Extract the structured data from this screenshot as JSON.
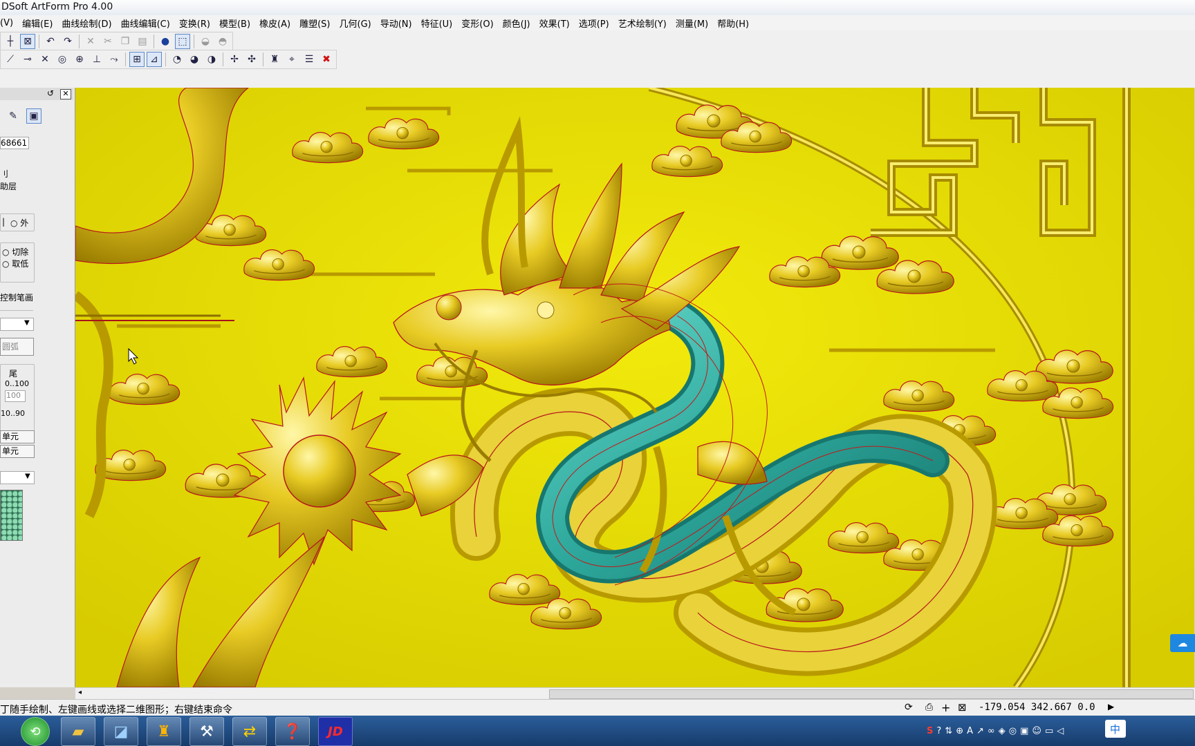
{
  "window": {
    "title": "DSoft ArtForm Pro 4.00"
  },
  "menu": [
    "(V)",
    "编辑(E)",
    "曲线绘制(D)",
    "曲线编辑(C)",
    "变换(R)",
    "模型(B)",
    "橡皮(A)",
    "雕塑(S)",
    "几何(G)",
    "导动(N)",
    "特征(U)",
    "变形(O)",
    "颜色(J)",
    "效果(T)",
    "选项(P)",
    "艺术绘制(Y)",
    "测量(M)",
    "帮助(H)"
  ],
  "panel": {
    "value_field": "68661",
    "label_line1": "刂",
    "label_line2": "助层",
    "radio_outer": "外",
    "radio_cut": "切除",
    "radio_lower": "取低",
    "control_pen": "控制笔画",
    "arc_button": "圆弧",
    "tail_label": "尾",
    "range1": "0..100",
    "range1_value": "100",
    "range2": "10..90",
    "unit_button1": "单元",
    "unit_button2": "单元"
  },
  "status": {
    "message": "丁随手绘制、左键画线或选择二维图形；右键结束命令",
    "coordinates": "-179.054 342.667 0.0"
  },
  "tray": {
    "ime_label": "中"
  },
  "colors": {
    "relief_gold": "#e0d000",
    "selection_teal": "#2ea89c",
    "outline_red": "#c21818"
  }
}
